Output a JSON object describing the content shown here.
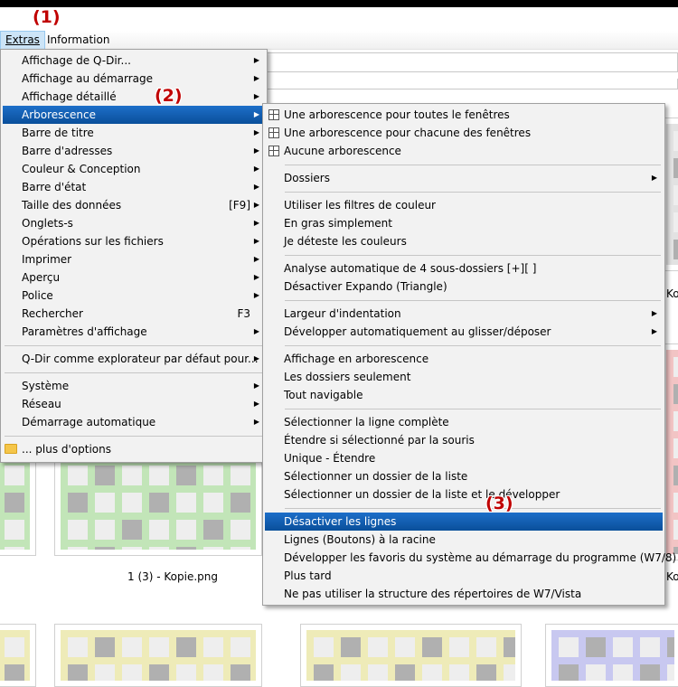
{
  "menubar": {
    "extras": "Extras",
    "information": "Information"
  },
  "annotations": {
    "a1": "(1)",
    "a2": "(2)",
    "a3": "(3)"
  },
  "captions": {
    "c1": "1 (3) - Kopie.png",
    "c2": "Ko",
    "c3": "Ko"
  },
  "menu_main": {
    "items": [
      "Affichage de Q-Dir...",
      "Affichage au démarrage",
      "Affichage détaillé",
      "Arborescence",
      "Barre de titre",
      "Barre d'adresses",
      "Couleur & Conception",
      "Barre d'état",
      "Taille des données",
      "Onglets-s",
      "Opérations sur les fichiers",
      "Imprimer",
      "Aperçu",
      "Police",
      "Rechercher",
      "Paramètres d'affichage",
      "Q-Dir comme explorateur par défaut pour...",
      "Système",
      "Réseau",
      "Démarrage automatique",
      "... plus d'options"
    ],
    "shortcut_taille": "[F9]",
    "shortcut_rechercher": "F3"
  },
  "menu_sub": {
    "items": [
      "Une arborescence pour toutes le fenêtres",
      "Une arborescence pour chacune des fenêtres",
      "Aucune arborescence",
      "Dossiers",
      "Utiliser les filtres de couleur",
      "En gras simplement",
      "Je déteste les couleurs",
      "Analyse automatique de 4 sous-dossiers [+][ ]",
      "Désactiver Expando (Triangle)",
      "Largeur d'indentation",
      "Développer automatiquement au glisser/déposer",
      "Affichage en arborescence",
      "Les dossiers seulement",
      "Tout navigable",
      "Sélectionner la ligne complète",
      "Étendre si sélectionné par la souris",
      "Unique - Étendre",
      "Sélectionner un dossier de la liste",
      "Sélectionner un dossier de la liste et le développer",
      "Désactiver les lignes",
      "Lignes (Boutons) à la racine",
      "Développer les favoris du système au démarrage du programme (W7/8)",
      "Plus tard",
      "Ne pas utiliser la structure des répertoires de W7/Vista"
    ]
  },
  "colors": {
    "highlight": "#0a4f9a",
    "annotation": "#c00000",
    "green": "#c2e5b8",
    "pink": "#f2c4c4",
    "yellow": "#eeebb8",
    "purple": "#c8c8f0",
    "gray": "#e2e2e2"
  }
}
